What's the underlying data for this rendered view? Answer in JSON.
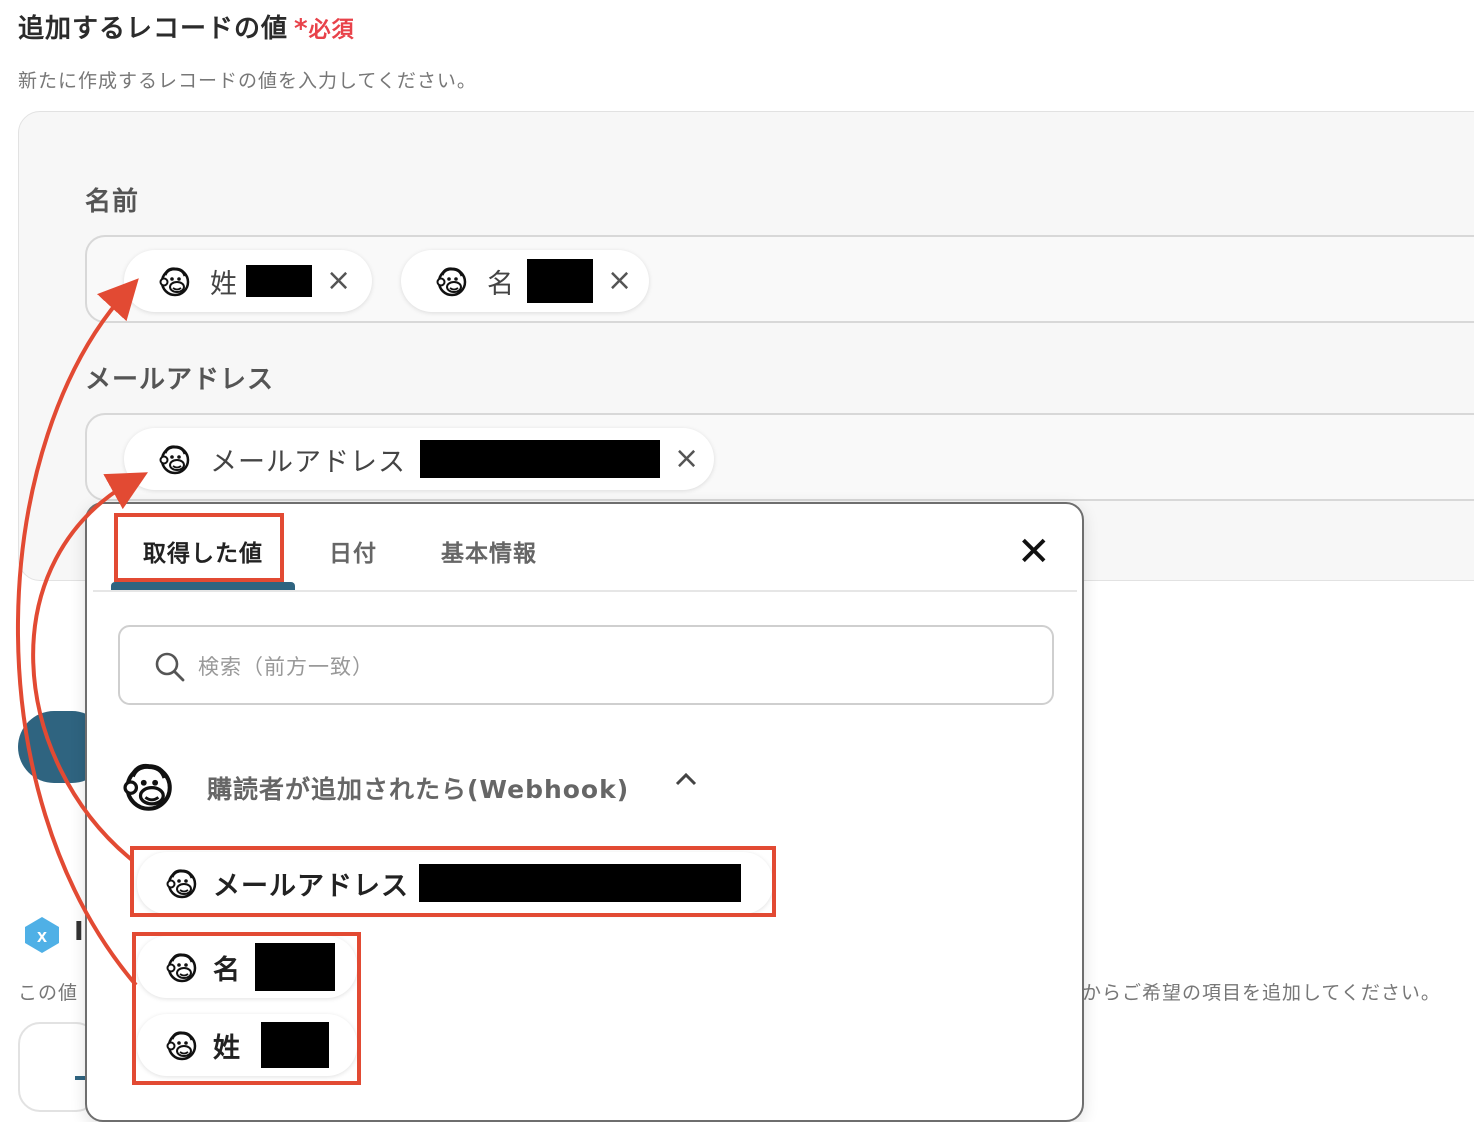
{
  "section": {
    "title": "追加するレコードの値",
    "required_star": "*",
    "required_label": "必須",
    "description": "新たに作成するレコードの値を入力してください。"
  },
  "fields": {
    "name": {
      "label": "名前",
      "chips": [
        {
          "label": "姓",
          "icon": "mailchimp-icon"
        },
        {
          "label": "名",
          "icon": "mailchimp-icon"
        }
      ]
    },
    "email": {
      "label": "メールアドレス",
      "chips": [
        {
          "label": "メールアドレス",
          "icon": "mailchimp-icon"
        }
      ]
    }
  },
  "chip_close": "×",
  "popup": {
    "tabs": [
      "取得した値",
      "日付",
      "基本情報"
    ],
    "active_tab": "取得した値",
    "close": "✕",
    "search_placeholder": "検索（前方一致）",
    "group": {
      "title": "購読者が追加されたら(Webhook)",
      "icon": "mailchimp-icon",
      "expanded": true,
      "caret": "^",
      "items": [
        "メールアドレス",
        "名",
        "姓"
      ]
    }
  },
  "lower": {
    "heading_initial": "I",
    "description_start": "この値",
    "description_end": "からご希望の項目を追加してください。"
  },
  "annotation_color": "#e24a33",
  "accent_color": "#2f6480"
}
